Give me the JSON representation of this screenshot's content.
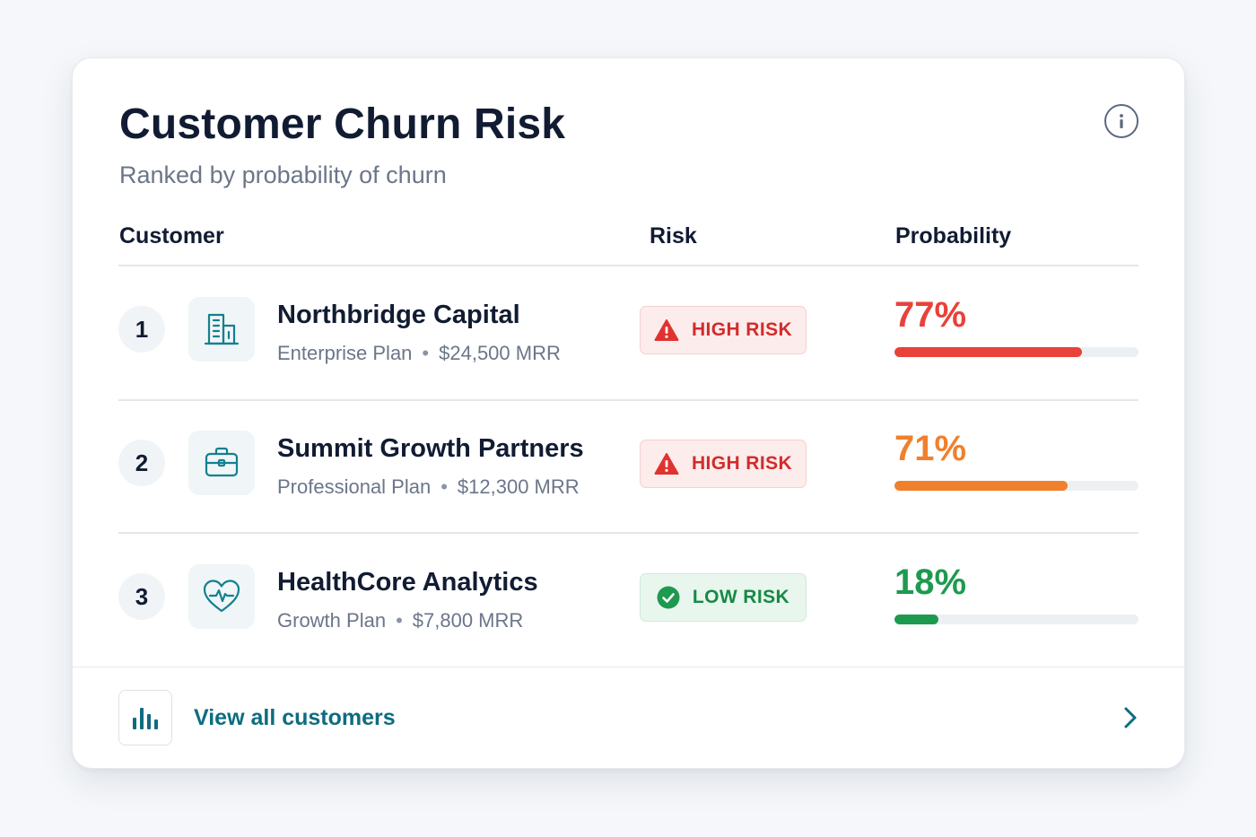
{
  "header": {
    "title": "Customer Churn Risk",
    "subtitle": "Ranked by probability of churn"
  },
  "columns": {
    "customer": "Customer",
    "risk": "Risk",
    "probability": "Probability"
  },
  "customers": [
    {
      "rank": "1",
      "icon": "building-icon",
      "name": "Northbridge Capital",
      "plan": "Enterprise Plan",
      "mrr": "$24,500 MRR",
      "risk_label": "HIGH RISK",
      "risk_level": "high",
      "probability_text": "77%",
      "probability": 0.77,
      "color": "#e8423a"
    },
    {
      "rank": "2",
      "icon": "briefcase-icon",
      "name": "Summit Growth Partners",
      "plan": "Professional Plan",
      "mrr": "$12,300 MRR",
      "risk_label": "HIGH RISK",
      "risk_level": "high",
      "probability_text": "71%",
      "probability": 0.71,
      "color": "#f0802c"
    },
    {
      "rank": "3",
      "icon": "heart-pulse-icon",
      "name": "HealthCore Analytics",
      "plan": "Growth Plan",
      "mrr": "$7,800 MRR",
      "risk_label": "LOW RISK",
      "risk_level": "low",
      "probability_text": "18%",
      "probability": 0.18,
      "color": "#1e9a50"
    }
  ],
  "footer": {
    "link_label": "View all customers",
    "icon": "bar-chart-icon"
  },
  "colors": {
    "accent": "#0e6c80",
    "high_risk": "#d32b2b",
    "low_risk": "#168a45"
  }
}
